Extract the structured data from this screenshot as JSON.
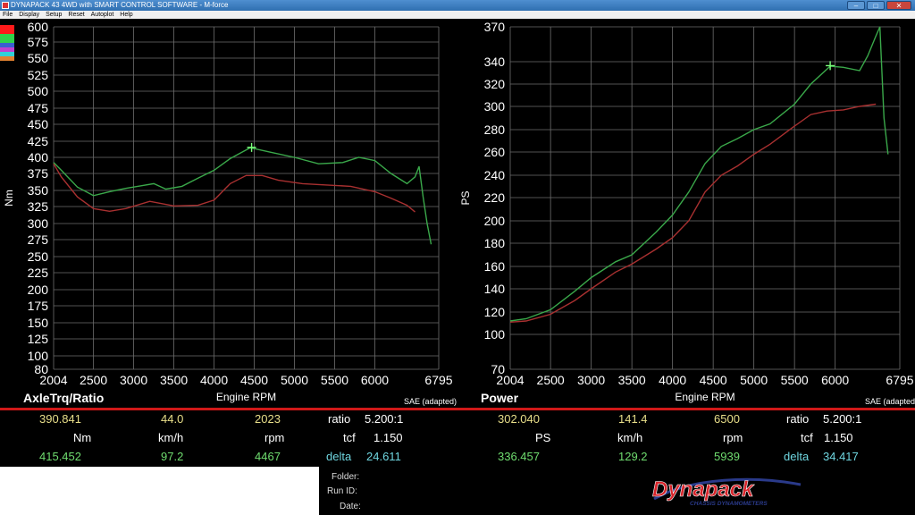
{
  "window": {
    "title": "DYNAPACK 43 4WD with SMART CONTROL SOFTWARE - M-force",
    "minimize": "–",
    "maximize": "□",
    "close": "✕"
  },
  "menu": [
    "File",
    "Display",
    "Setup",
    "Reset",
    "Autoplot",
    "Help"
  ],
  "swatch_colors": [
    "#ff1a1a",
    "#2fd24a",
    "#3a5fd0",
    "#c040d0",
    "#30d0d8",
    "#e08030"
  ],
  "chart_data": [
    {
      "type": "line",
      "title": "AxleTrq/Ratio",
      "xlabel": "Engine RPM",
      "ylabel": "Nm",
      "note": "SAE (adapted)",
      "xlim": [
        2004,
        6795
      ],
      "ylim": [
        80,
        600
      ],
      "x_ticks": [
        "2004",
        "2500",
        "3000",
        "3500",
        "4000",
        "4500",
        "5000",
        "5500",
        "6000",
        "6795"
      ],
      "y_ticks": [
        80,
        100,
        125,
        150,
        175,
        200,
        225,
        250,
        275,
        300,
        325,
        350,
        375,
        400,
        425,
        450,
        475,
        500,
        525,
        550,
        575,
        600
      ],
      "grid": true,
      "series": [
        {
          "color": "#3aa84a",
          "x": [
            2004,
            2100,
            2300,
            2500,
            2700,
            2900,
            3100,
            3250,
            3400,
            3600,
            3800,
            4000,
            4200,
            4450,
            4700,
            5000,
            5300,
            5600,
            5800,
            6000,
            6200,
            6400,
            6500,
            6550,
            6600,
            6650,
            6700
          ],
          "y": [
            392,
            380,
            355,
            342,
            348,
            353,
            357,
            360,
            352,
            356,
            368,
            380,
            398,
            415,
            408,
            400,
            390,
            392,
            400,
            395,
            375,
            360,
            370,
            386,
            340,
            300,
            268
          ]
        },
        {
          "color": "#a83030",
          "x": [
            2004,
            2100,
            2300,
            2500,
            2700,
            2900,
            3200,
            3500,
            3800,
            4000,
            4200,
            4400,
            4600,
            4800,
            5100,
            5400,
            5700,
            6000,
            6200,
            6400,
            6500
          ],
          "y": [
            390,
            370,
            340,
            322,
            318,
            322,
            333,
            326,
            327,
            335,
            360,
            372,
            372,
            365,
            360,
            358,
            356,
            348,
            338,
            327,
            317
          ]
        }
      ],
      "marker": {
        "x": 4467,
        "y": 415.452
      }
    },
    {
      "type": "line",
      "title": "Power",
      "xlabel": "Engine RPM",
      "ylabel": "PS",
      "note": "SAE (adapted)",
      "xlim": [
        2004,
        6795
      ],
      "ylim": [
        70,
        370
      ],
      "x_ticks": [
        "2004",
        "2500",
        "3000",
        "3500",
        "4000",
        "4500",
        "5000",
        "5500",
        "6000",
        "6795"
      ],
      "y_ticks": [
        70,
        100,
        120,
        140,
        160,
        180,
        200,
        220,
        240,
        260,
        280,
        300,
        320,
        340,
        370
      ],
      "grid": true,
      "series": [
        {
          "color": "#3aa84a",
          "x": [
            2004,
            2200,
            2500,
            2800,
            3000,
            3300,
            3500,
            3800,
            4000,
            4200,
            4400,
            4600,
            4800,
            5000,
            5200,
            5500,
            5700,
            5939,
            6100,
            6300,
            6400,
            6500,
            6550,
            6600,
            6650
          ],
          "y": [
            112,
            114,
            122,
            138,
            150,
            164,
            170,
            190,
            205,
            225,
            250,
            265,
            272,
            280,
            285,
            302,
            320,
            336,
            335,
            332,
            345,
            362,
            370,
            290,
            258
          ]
        },
        {
          "color": "#a83030",
          "x": [
            2004,
            2200,
            2500,
            2800,
            3000,
            3300,
            3500,
            3800,
            4000,
            4200,
            4400,
            4600,
            4800,
            5000,
            5200,
            5500,
            5700,
            5900,
            6100,
            6300,
            6500
          ],
          "y": [
            111,
            112,
            118,
            130,
            140,
            155,
            162,
            175,
            185,
            200,
            225,
            240,
            248,
            258,
            267,
            283,
            293,
            296,
            297,
            300,
            302
          ]
        }
      ],
      "marker": {
        "x": 5939,
        "y": 336.457
      }
    }
  ],
  "left_readout": {
    "title": "AxleTrq/Ratio",
    "rpm_axis": "Engine RPM",
    "sae": "SAE (adapted)",
    "row1": {
      "value": "390.841",
      "speed": "44.0",
      "rpm": "2023",
      "ratio_label": "ratio",
      "ratio": "5.200:1"
    },
    "units": {
      "unit": "Nm",
      "speed": "km/h",
      "rpm": "rpm",
      "tcf_label": "tcf",
      "tcf": "1.150"
    },
    "row2": {
      "value": "415.452",
      "speed": "97.2",
      "rpm": "4467",
      "delta_label": "delta",
      "delta": "24.611"
    }
  },
  "right_readout": {
    "title": "Power",
    "rpm_axis": "Engine RPM",
    "sae": "SAE (adapted)",
    "row1": {
      "value": "302.040",
      "speed": "141.4",
      "rpm": "6500",
      "ratio_label": "ratio",
      "ratio": "5.200:1"
    },
    "units": {
      "unit": "PS",
      "speed": "km/h",
      "rpm": "rpm",
      "tcf_label": "tcf",
      "tcf": "1.150"
    },
    "row2": {
      "value": "336.457",
      "speed": "129.2",
      "rpm": "5939",
      "delta_label": "delta",
      "delta": "34.417"
    }
  },
  "meta": {
    "folder": "Folder:",
    "run_id": "Run ID:",
    "date": "Date:"
  },
  "logo": {
    "brand": "Dynapack",
    "tagline": "CHASSIS DYNAMOMETERS"
  }
}
